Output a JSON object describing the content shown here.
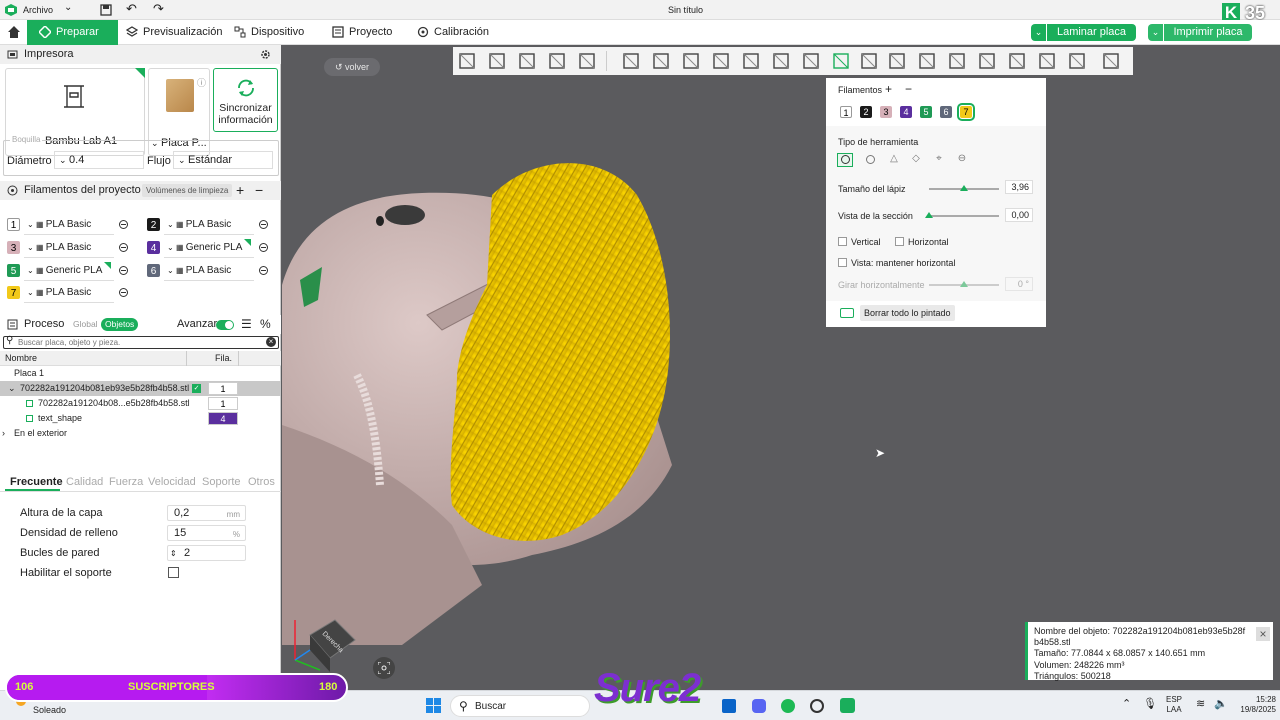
{
  "titlebar": {
    "menu": "Archivo",
    "title": "Sin título",
    "counter": "35"
  },
  "nav": {
    "tabs": [
      "Preparar",
      "Previsualización",
      "Dispositivo",
      "Proyecto",
      "Calibración"
    ],
    "slice": "Laminar placa",
    "print": "Imprimir placa"
  },
  "printer": {
    "section": "Impresora",
    "name": "Bambu Lab A1",
    "plate": "Placa P...",
    "sync": [
      "Sincronizar",
      "información"
    ],
    "nozzle_legend": "Boquilla",
    "diameter_label": "Diámetro",
    "diameter": "0.4",
    "flow_label": "Flujo",
    "flow": "Estándar"
  },
  "filaments": {
    "section": "Filamentos del proyecto",
    "flush": "Volúmenes de limpieza",
    "items": [
      {
        "num": "1",
        "name": "PLA Basic",
        "color": "#ffffff",
        "text": "#000000"
      },
      {
        "num": "2",
        "name": "PLA Basic",
        "color": "#1a1a1a",
        "text": "#ffffff"
      },
      {
        "num": "3",
        "name": "PLA Basic",
        "color": "#d6b0b8",
        "text": "#000000"
      },
      {
        "num": "4",
        "name": "Generic PLA",
        "color": "#5a2f9e",
        "text": "#ffffff"
      },
      {
        "num": "5",
        "name": "Generic PLA",
        "color": "#1f9a55",
        "text": "#ffffff"
      },
      {
        "num": "6",
        "name": "PLA Basic",
        "color": "#60687a",
        "text": "#ffffff"
      },
      {
        "num": "7",
        "name": "PLA Basic",
        "color": "#f2c919",
        "text": "#000000"
      }
    ]
  },
  "process": {
    "section": "Proceso",
    "global": "Global",
    "objects": "Objetos",
    "advanced": "Avanzar",
    "search_placeholder": "Buscar placa, objeto y pieza.",
    "col_name": "Nombre",
    "col_fil": "Fila.",
    "tree": [
      {
        "label": "Placa 1"
      },
      {
        "label": "702282a191204b081eb93e5b28fb4b58.stl",
        "fil": "1"
      },
      {
        "label": "702282a191204b08...e5b28fb4b58.stl",
        "fil": "1"
      },
      {
        "label": "text_shape",
        "fil": "4"
      },
      {
        "label": "En el exterior"
      }
    ],
    "tabs": [
      "Frecuente",
      "Calidad",
      "Fuerza",
      "Velocidad",
      "Soporte",
      "Otros"
    ],
    "params": [
      {
        "label": "Altura de la capa",
        "value": "0,2",
        "unit": "mm"
      },
      {
        "label": "Densidad de relleno",
        "value": "15",
        "unit": "%"
      },
      {
        "label": "Bucles de pared",
        "value": "2",
        "unit": ""
      },
      {
        "label": "Habilitar el soporte",
        "value": "",
        "unit": ""
      }
    ]
  },
  "viewport": {
    "back": "volver",
    "cube_label": "Derecha"
  },
  "paint": {
    "filaments_title": "Filamentos",
    "chips": [
      "1",
      "2",
      "3",
      "4",
      "5",
      "6",
      "7"
    ],
    "tool_type": "Tipo de herramienta",
    "pen_size_label": "Tamaño del lápiz",
    "pen_size": "3,96",
    "pen_size_fraction": 0.5,
    "section_label": "Vista de la sección",
    "section": "0,00",
    "section_fraction": 0.0,
    "vertical": "Vertical",
    "horizontal": "Horizontal",
    "keep_horizontal": "Vista: mantener horizontal",
    "rotate_label": "Girar horizontalmente",
    "rotate": "0 °",
    "clear": "Borrar todo lo pintado"
  },
  "info": {
    "name": "Nombre del objeto: 702282a191204b081eb93e5b28f",
    "name2": "b4b58.stl",
    "size": "Tamaño: 77.0844 x 68.0857 x 140.651 mm",
    "volume": "Volumen: 248226 mm³",
    "triangles": "Triángulos: 500218"
  },
  "overlay": {
    "left": "106",
    "label": "SUSCRIPTORES",
    "right": "180",
    "fraction": 0.59,
    "brand": "Sure2"
  },
  "taskbar": {
    "weather": "Soleado",
    "search": "Buscar",
    "lang1": "ESP",
    "lang2": "LAA",
    "time": "15:28",
    "date": "19/8/2025"
  },
  "colors": {
    "accent": "#1aae5b",
    "hair": "#f0c900",
    "skin": "#cbb5b3"
  }
}
